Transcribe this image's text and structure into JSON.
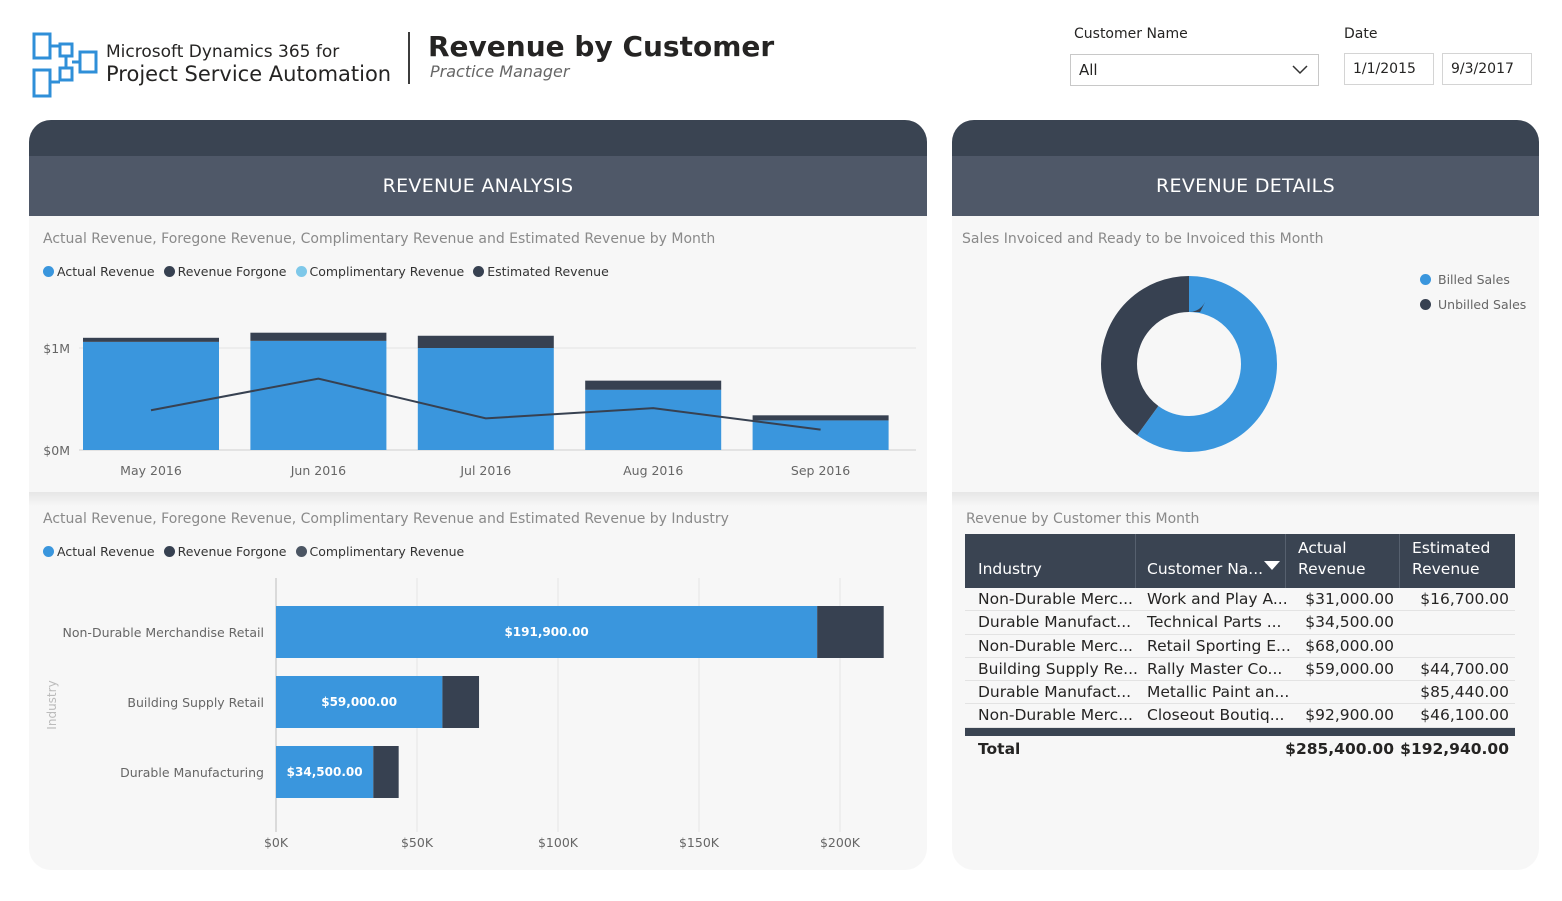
{
  "header": {
    "brand_line1": "Microsoft Dynamics 365 for",
    "brand_line2": "Project Service Automation",
    "title": "Revenue by Customer",
    "subtitle": "Practice Manager"
  },
  "filters": {
    "customer_label": "Customer Name",
    "customer_value": "All",
    "date_label": "Date",
    "date_start": "1/1/2015",
    "date_end": "9/3/2017"
  },
  "left_panel": {
    "heading": "REVENUE ANALYSIS",
    "chart1_title": "Actual Revenue, Foregone Revenue, Complimentary Revenue and Estimated Revenue by Month",
    "chart1_legend": [
      "Actual Revenue",
      "Revenue Forgone",
      "Complimentary Revenue",
      "Estimated Revenue"
    ],
    "chart2_title": "Actual Revenue, Foregone Revenue, Complimentary Revenue and Estimated Revenue by Industry",
    "chart2_legend": [
      "Actual Revenue",
      "Revenue Forgone",
      "Complimentary Revenue"
    ]
  },
  "right_panel": {
    "heading": "REVENUE DETAILS",
    "chart3_title": "Sales Invoiced and Ready to be Invoiced this Month",
    "chart3_legend": [
      "Billed Sales",
      "Unbilled Sales"
    ],
    "table_title": "Revenue by Customer this Month"
  },
  "colors": {
    "actual": "#3a96dd",
    "forgone": "#374151",
    "complimentary": "#7ec8e9",
    "estimated": "#374151",
    "header_dark": "#3a4452",
    "header_mid": "#4f5868"
  },
  "chart_data": [
    {
      "type": "bar",
      "stacked": true,
      "categories": [
        "May 2016",
        "Jun 2016",
        "Jul 2016",
        "Aug 2016",
        "Sep 2016"
      ],
      "series": [
        {
          "name": "Actual Revenue",
          "values": [
            1060000,
            1070000,
            1000000,
            590000,
            290000
          ]
        },
        {
          "name": "Revenue Forgone",
          "values": [
            40000,
            80000,
            120000,
            90000,
            50000
          ]
        }
      ],
      "line_series": {
        "name": "Estimated Revenue",
        "values": [
          390000,
          700000,
          310000,
          410000,
          200000
        ]
      },
      "y_ticks": [
        "$0M",
        "$1M"
      ],
      "ylim": [
        0,
        1180000
      ]
    },
    {
      "type": "bar",
      "orientation": "horizontal",
      "stacked": true,
      "categories": [
        "Non-Durable Merchandise Retail",
        "Building Supply Retail",
        "Durable Manufacturing"
      ],
      "ylabel": "Industry",
      "series": [
        {
          "name": "Actual Revenue",
          "values": [
            191900,
            59000,
            34500
          ],
          "labels": [
            "$191,900.00",
            "$59,000.00",
            "$34,500.00"
          ]
        },
        {
          "name": "Revenue Forgone",
          "values": [
            23600,
            13000,
            9000
          ]
        }
      ],
      "x_ticks": [
        "$0K",
        "$50K",
        "$100K",
        "$150K",
        "$200K"
      ],
      "xlim": [
        0,
        200000
      ]
    },
    {
      "type": "pie",
      "donut": true,
      "labels": [
        "Billed Sales",
        "Unbilled Sales"
      ],
      "values": [
        60,
        40
      ]
    },
    {
      "type": "table",
      "columns": [
        "Industry",
        "Customer Na...",
        "Actual Revenue",
        "Estimated Revenue"
      ],
      "rows": [
        [
          "Non-Durable Merc...",
          "Work and Play A...",
          "$31,000.00",
          "$16,700.00"
        ],
        [
          "Durable Manufact...",
          "Technical Parts ...",
          "$34,500.00",
          ""
        ],
        [
          "Non-Durable Merc...",
          "Retail Sporting E...",
          "$68,000.00",
          ""
        ],
        [
          "Building Supply Re...",
          "Rally Master Co...",
          "$59,000.00",
          "$44,700.00"
        ],
        [
          "Durable Manufact...",
          "Metallic Paint an...",
          "",
          "$85,440.00"
        ],
        [
          "Non-Durable Merc...",
          "Closeout Boutiq...",
          "$92,900.00",
          "$46,100.00"
        ]
      ],
      "total": [
        "Total",
        "",
        "$285,400.00",
        "$192,940.00"
      ]
    }
  ]
}
